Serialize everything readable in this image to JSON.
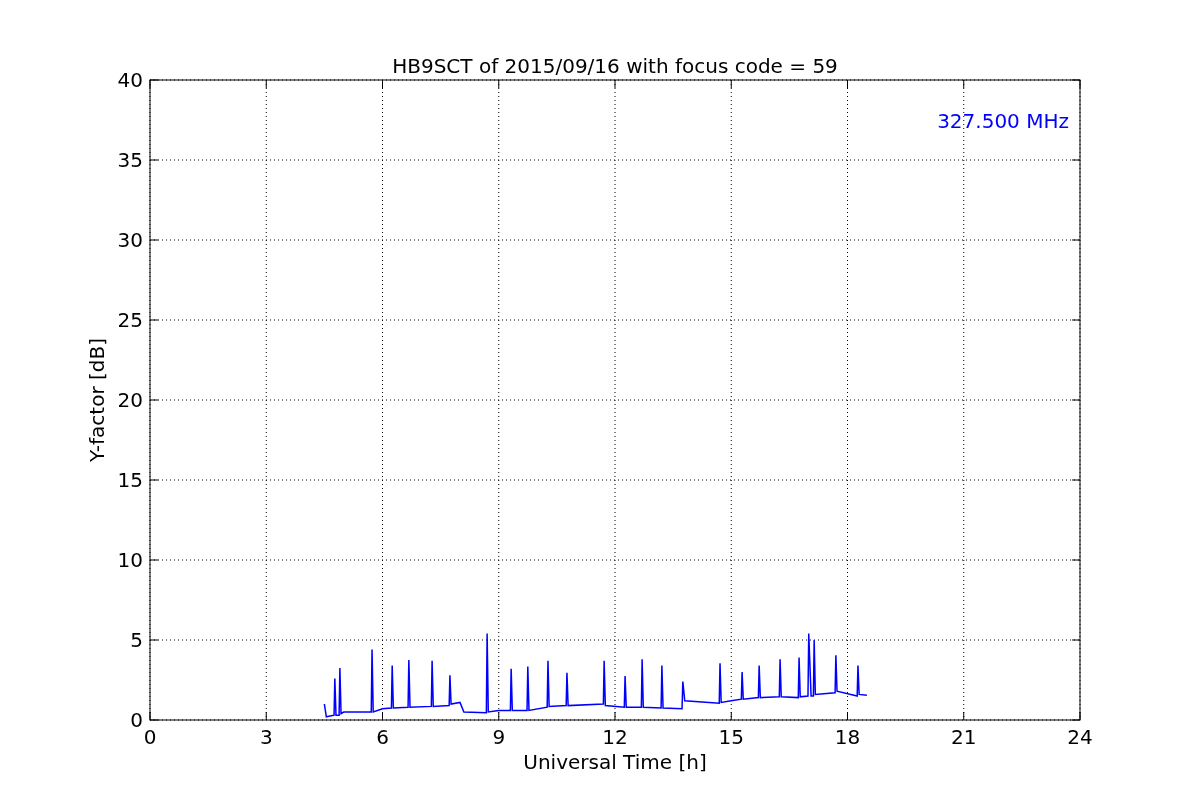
{
  "chart_data": {
    "type": "line",
    "title": "HB9SCT of 2015/09/16 with focus code = 59",
    "xlabel": "Universal Time [h]",
    "ylabel": "Y-factor [dB]",
    "xlim": [
      0,
      24
    ],
    "ylim": [
      0,
      40
    ],
    "xticks": [
      0,
      3,
      6,
      9,
      12,
      15,
      18,
      21,
      24
    ],
    "yticks": [
      0,
      5,
      10,
      15,
      20,
      25,
      30,
      35,
      40
    ],
    "x": [
      4.5,
      4.55,
      4.75,
      4.77,
      4.8,
      4.88,
      4.9,
      4.93,
      5.0,
      5.71,
      5.73,
      5.76,
      6.0,
      6.23,
      6.25,
      6.28,
      6.66,
      6.68,
      6.71,
      7.26,
      7.28,
      7.31,
      7.72,
      7.74,
      7.77,
      8.0,
      8.1,
      8.68,
      8.7,
      8.73,
      9.0,
      9.3,
      9.32,
      9.35,
      9.73,
      9.75,
      9.78,
      10.25,
      10.27,
      10.3,
      10.74,
      10.76,
      10.79,
      11.7,
      11.72,
      11.75,
      12.24,
      12.26,
      12.29,
      12.68,
      12.7,
      12.73,
      13.19,
      13.21,
      13.24,
      13.73,
      13.75,
      13.8,
      14.69,
      14.71,
      14.74,
      15.0,
      15.26,
      15.28,
      15.31,
      15.7,
      15.72,
      15.75,
      16.24,
      16.26,
      16.29,
      16.73,
      16.75,
      16.78,
      16.98,
      17.0,
      17.06,
      17.12,
      17.14,
      17.17,
      17.68,
      17.7,
      17.73,
      18.25,
      18.27,
      18.3,
      18.5
    ],
    "series": [
      {
        "name": "327.500 MHz",
        "color": "#0000ff",
        "values": [
          1.0,
          0.2,
          0.3,
          2.6,
          0.3,
          0.3,
          3.25,
          0.4,
          0.5,
          0.5,
          4.4,
          0.5,
          0.7,
          0.75,
          3.4,
          0.75,
          0.8,
          3.75,
          0.8,
          0.85,
          3.7,
          0.85,
          0.9,
          2.8,
          1.0,
          1.1,
          0.5,
          0.45,
          5.4,
          0.5,
          0.6,
          0.6,
          3.2,
          0.6,
          0.6,
          3.35,
          0.6,
          0.8,
          3.7,
          0.85,
          0.9,
          2.95,
          0.9,
          1.0,
          3.7,
          0.9,
          0.8,
          2.75,
          0.8,
          0.8,
          3.8,
          0.8,
          0.75,
          3.4,
          0.75,
          0.7,
          2.4,
          1.2,
          1.05,
          3.55,
          1.1,
          1.2,
          1.3,
          3.0,
          1.3,
          1.4,
          3.4,
          1.4,
          1.45,
          3.8,
          1.45,
          1.4,
          3.9,
          1.45,
          1.5,
          5.4,
          1.5,
          1.5,
          5.0,
          1.6,
          1.7,
          4.05,
          1.8,
          1.5,
          3.4,
          1.6,
          1.55
        ]
      }
    ],
    "grid": true
  }
}
